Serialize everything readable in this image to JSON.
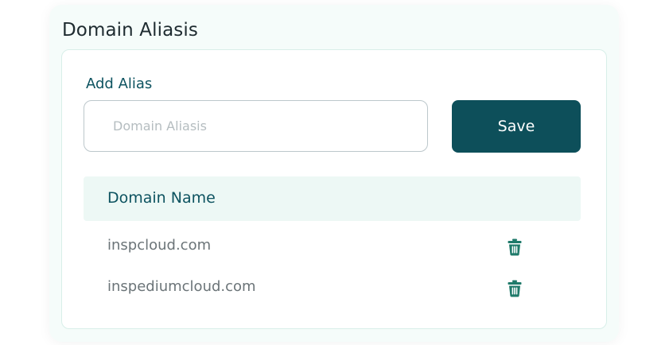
{
  "section": {
    "title": "Domain Aliasis"
  },
  "form": {
    "label": "Add Alias",
    "input_placeholder": "Domain Aliasis",
    "input_value": "",
    "save_label": "Save"
  },
  "table": {
    "column_header": "Domain Name",
    "rows": [
      {
        "domain": "inspcloud.com",
        "action_icon": "trash-icon"
      },
      {
        "domain": "inspediumcloud.com",
        "action_icon": "trash-icon"
      }
    ]
  },
  "colors": {
    "accent": "#0d4f5a",
    "panel_bg": "#f5fcfa",
    "header_bg": "#edf8f5",
    "icon": "#1f7a6a"
  }
}
